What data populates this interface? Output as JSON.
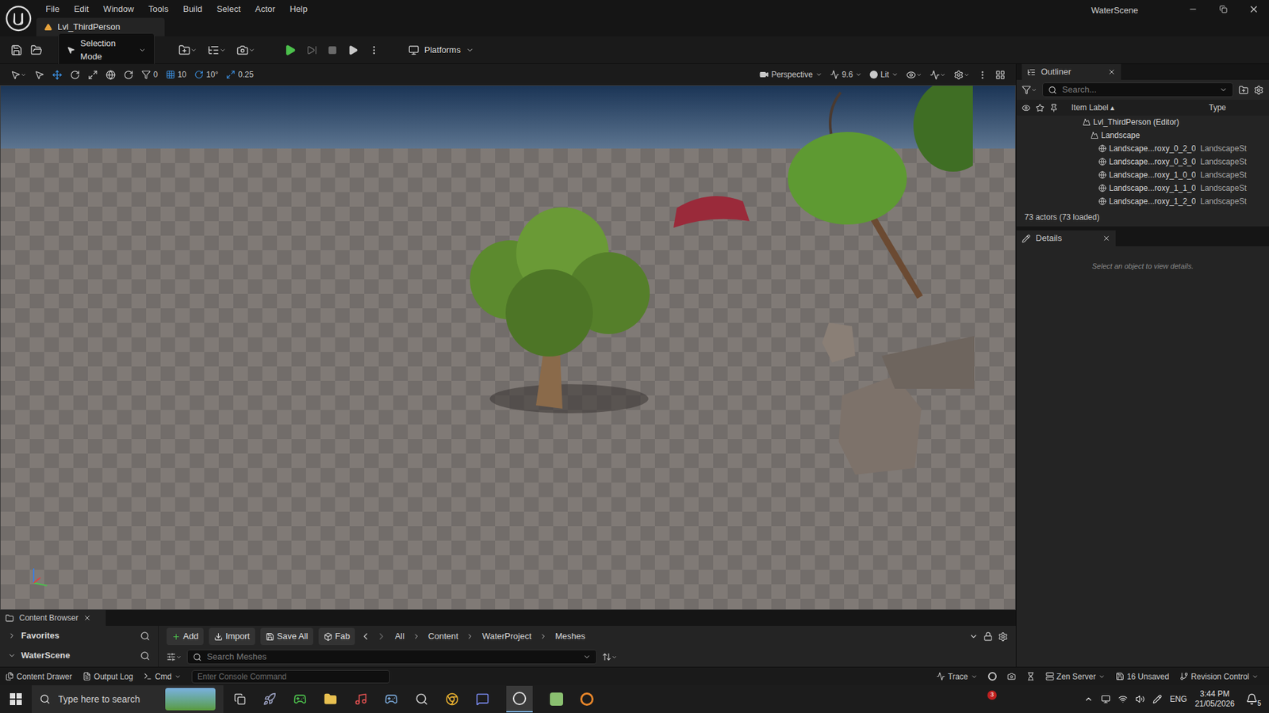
{
  "window": {
    "title": "WaterScene"
  },
  "menu": [
    "File",
    "Edit",
    "Window",
    "Tools",
    "Build",
    "Select",
    "Actor",
    "Help"
  ],
  "level_tab": {
    "label": "Lvl_ThirdPerson"
  },
  "toolbar": {
    "mode": "Selection Mode",
    "platforms": "Platforms"
  },
  "viewport_toolbar": {
    "rotation_snap": "0",
    "grid_snap": "10",
    "angle_snap": "10°",
    "scale_snap": "0.25",
    "view": "Perspective",
    "camera_speed": "9.6",
    "view_mode": "Lit"
  },
  "outliner": {
    "title": "Outliner",
    "search_placeholder": "Search...",
    "columns": [
      "Item Label",
      "Type"
    ],
    "rows": [
      {
        "label": "Lvl_ThirdPerson (Editor)",
        "type": "",
        "depth": 0
      },
      {
        "label": "Landscape",
        "type": "",
        "depth": 1
      },
      {
        "label": "Landscape...roxy_0_2_0",
        "type": "LandscapeSt",
        "depth": 2
      },
      {
        "label": "Landscape...roxy_0_3_0",
        "type": "LandscapeSt",
        "depth": 2
      },
      {
        "label": "Landscape...roxy_1_0_0",
        "type": "LandscapeSt",
        "depth": 2
      },
      {
        "label": "Landscape...roxy_1_1_0",
        "type": "LandscapeSt",
        "depth": 2
      },
      {
        "label": "Landscape...roxy_1_2_0",
        "type": "LandscapeSt",
        "depth": 2
      }
    ],
    "count": "73 actors (73 loaded)"
  },
  "details": {
    "title": "Details",
    "message": "Select an object to view details."
  },
  "content_browser": {
    "title": "Content Browser",
    "sidebar": [
      {
        "label": "Favorites",
        "expanded": false
      },
      {
        "label": "WaterScene",
        "expanded": true
      }
    ],
    "buttons": [
      "Add",
      "Import",
      "Save All",
      "Fab"
    ],
    "path": [
      "All",
      "Content",
      "WaterProject",
      "Meshes"
    ],
    "search_placeholder": "Search Meshes"
  },
  "status_bar": {
    "content_drawer": "Content Drawer",
    "output_log": "Output Log",
    "cmd": "Cmd",
    "console_placeholder": "Enter Console Command",
    "trace": "Trace",
    "zen_server": "Zen Server",
    "unsaved": "16 Unsaved",
    "revision_control": "Revision Control"
  },
  "taskbar": {
    "search_placeholder": "Type here to search",
    "badge": "3",
    "language": "ENG",
    "time": "3:44 PM",
    "date": "21/05/2026",
    "notifications": "5"
  }
}
